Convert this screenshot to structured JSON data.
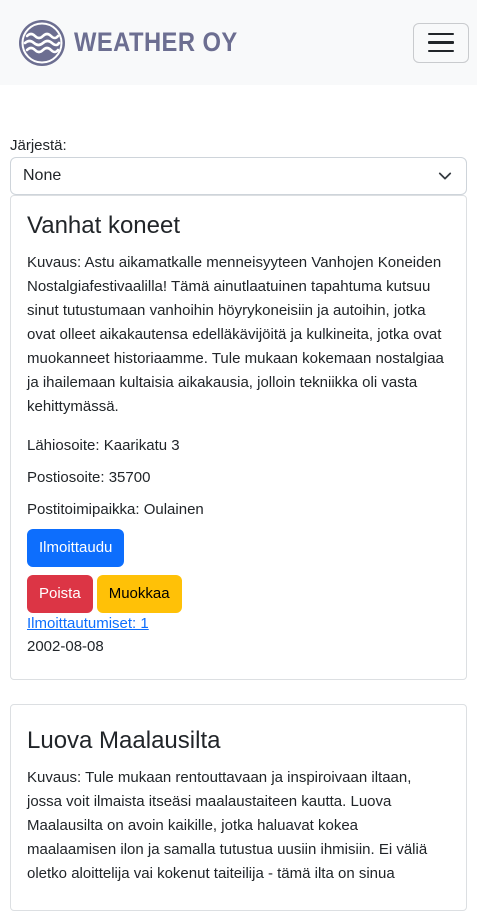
{
  "brand": {
    "name": "WEATHER OY",
    "logo_icon": "wave-logo-icon"
  },
  "nav": {
    "toggle_icon": "hamburger-icon"
  },
  "sort": {
    "label": "Järjestä:",
    "selected": "None",
    "icon": "chevron-down-icon"
  },
  "events": [
    {
      "title": "Vanhat koneet",
      "description": "Kuvaus: Astu aikamatkalle menneisyyteen Vanhojen Koneiden Nostalgiafestivaalilla! Tämä ainutlaatuinen tapahtuma kutsuu sinut tutustumaan vanhoihin höyrykoneisiin ja autoihin, jotka ovat olleet aikakautensa edelläkävijöitä ja kulkineita, jotka ovat muokanneet historiaamme. Tule mukaan kokemaan nostalgiaa ja ihailemaan kultaisia aikakausia, jolloin tekniikka oli vasta kehittymässä.",
      "address": "Lähiosoite: Kaarikatu 3",
      "postal_code": "Postiosoite: 35700",
      "city": "Postitoimipaikka: Oulainen",
      "register_label": "Ilmoittaudu",
      "delete_label": "Poista",
      "edit_label": "Muokkaa",
      "registrations_link": "Ilmoittautumiset: 1",
      "date": "2002-08-08"
    },
    {
      "title": "Luova Maalausilta",
      "description": "Kuvaus: Tule mukaan rentouttavaan ja inspiroivaan iltaan, jossa voit ilmaista itseäsi maalaustaiteen kautta. Luova Maalausilta on avoin kaikille, jotka haluavat kokea maalaamisen ilon ja samalla tutustua uusiin ihmisiin. Ei väliä oletko aloittelija vai kokenut taiteilija - tämä ilta on sinua"
    }
  ],
  "colors": {
    "primary": "#0d6efd",
    "danger": "#dc3545",
    "warning": "#ffc107",
    "brand": "#6c6e91",
    "navbar_bg": "#f8f9fa"
  }
}
